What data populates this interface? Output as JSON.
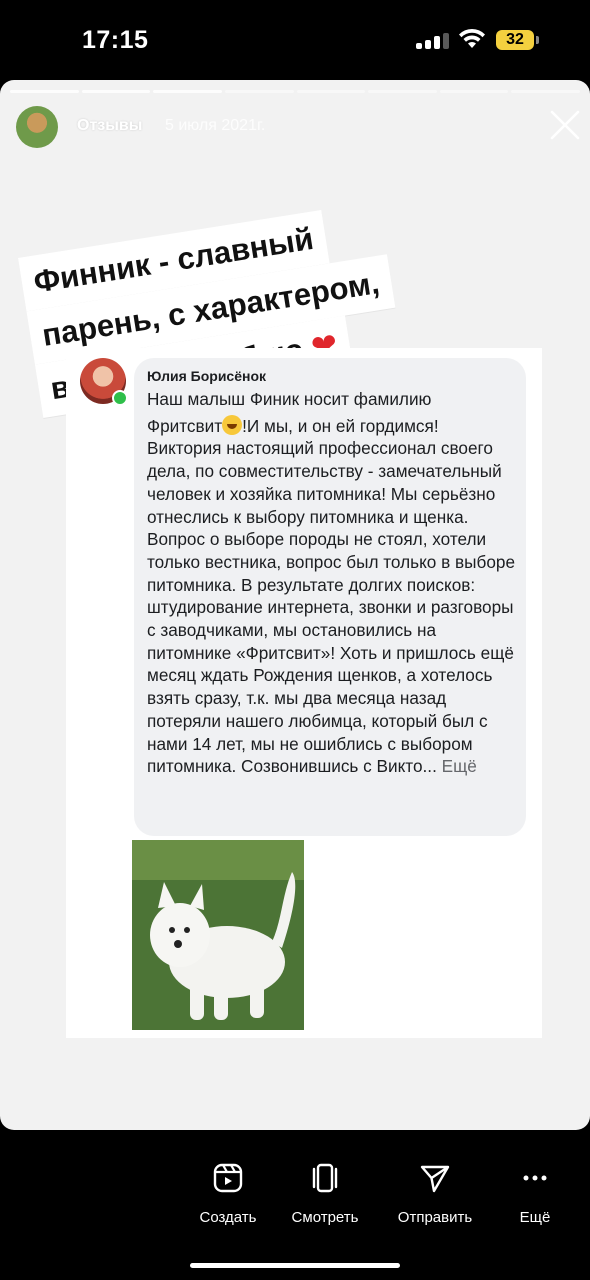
{
  "status_bar": {
    "time": "17:15",
    "battery": "32"
  },
  "story": {
    "account_name": "Отзывы",
    "date": "5 июля 2021г.",
    "progress_segments": 8,
    "active_segment": 4,
    "caption_lines": [
      "Финник - славный",
      "парень, с характером,",
      "все как я люблю"
    ],
    "caption_emoji": "❤"
  },
  "comment": {
    "author": "Юлия Борисёнок",
    "line1": "Наш малыш Финик носит фамилию",
    "line2_before_emoji": "Фритсвит",
    "line2_after_emoji": "!И мы, и он ей гордимся!",
    "body": "Виктория настоящий профессионал своего дела, по совместительству - замечательный человек и хозяйка питомника! Мы серьёзно отнеслись к выбору питомника и щенка. Вопрос о выборе породы не стоял, хотели только вестника, вопрос был только в выборе питомника. В результате долгих поисков: штудирование интернета, звонки и разговоры с заводчиками, мы остановились на питомнике «Фритсвит»! Хоть и пришлось ещё месяц ждать Рождения щенков, а хотелось взять сразу, т.к. мы два месяца назад потеряли нашего любимца, который был с нами 14 лет, мы не ошиблись с выбором питомника. Созвонившись с Викто...",
    "more": "Ещё"
  },
  "bottom_actions": [
    {
      "label": "Создать",
      "icon": "create-icon"
    },
    {
      "label": "Смотреть",
      "icon": "view-icon"
    },
    {
      "label": "Отправить",
      "icon": "send-icon"
    },
    {
      "label": "Ещё",
      "icon": "more-icon"
    }
  ]
}
